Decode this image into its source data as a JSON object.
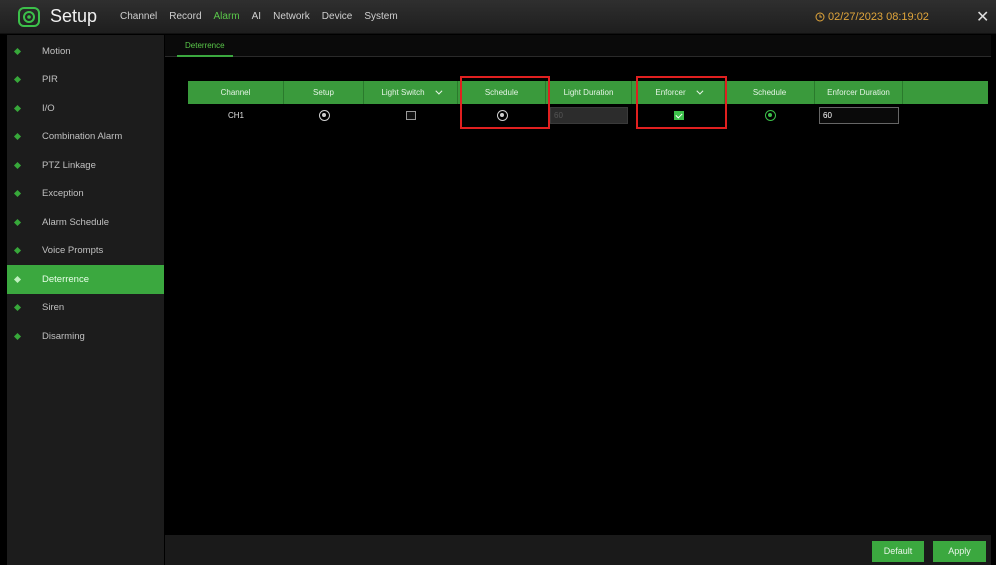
{
  "app": {
    "title": "Setup",
    "datetime": "02/27/2023 08:19:02",
    "close_icon": "close-icon",
    "logo_icon": "gear-logo-icon"
  },
  "nav": {
    "items": [
      "Channel",
      "Record",
      "Alarm",
      "AI",
      "Network",
      "Device",
      "System"
    ],
    "active": "Alarm"
  },
  "sidebar": {
    "items": [
      {
        "label": "Motion"
      },
      {
        "label": "PIR"
      },
      {
        "label": "I/O"
      },
      {
        "label": "Combination Alarm"
      },
      {
        "label": "PTZ Linkage"
      },
      {
        "label": "Exception"
      },
      {
        "label": "Alarm Schedule"
      },
      {
        "label": "Voice Prompts"
      },
      {
        "label": "Deterrence"
      },
      {
        "label": "Siren"
      },
      {
        "label": "Disarming"
      }
    ],
    "active": "Deterrence"
  },
  "subtabs": [
    "Deterrence"
  ],
  "table": {
    "headers": [
      "Channel",
      "Setup",
      "Light Switch",
      "Schedule",
      "Light Duration",
      "Enforcer",
      "Schedule",
      "Enforcer Duration"
    ],
    "rows": [
      {
        "channel": "CH1",
        "setup_icon": "gear-icon",
        "light_switch": false,
        "schedule_icon": "gear-icon",
        "light_duration": "60",
        "enforcer": true,
        "enforcer_schedule_icon": "gear-icon",
        "enforcer_duration": "60"
      }
    ]
  },
  "footer": {
    "default_label": "Default",
    "apply_label": "Apply"
  },
  "colors": {
    "accent": "#3ba83f",
    "highlight_box": "#e02020",
    "clock": "#e0a53b"
  }
}
